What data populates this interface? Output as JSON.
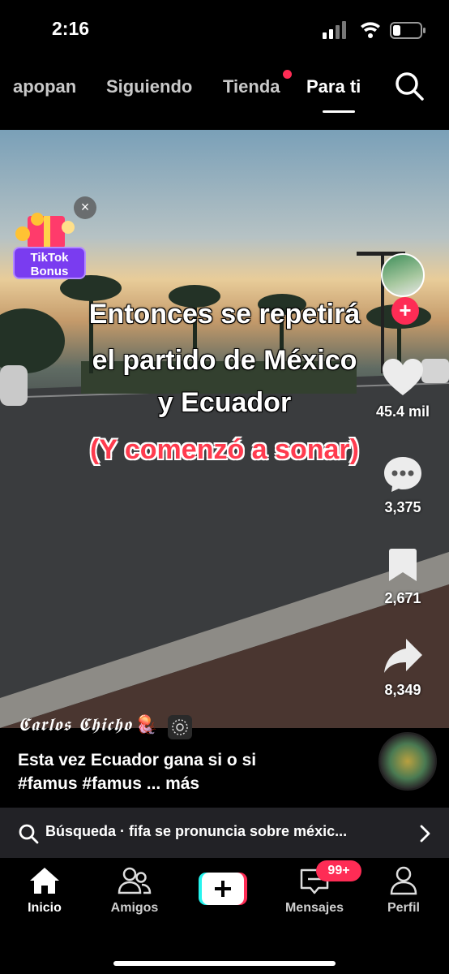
{
  "status_bar": {
    "time": "2:16"
  },
  "top_nav": {
    "tabs": [
      {
        "label": "apopan"
      },
      {
        "label": "Siguiendo"
      },
      {
        "label": "Tienda"
      },
      {
        "label": "Para ti"
      }
    ]
  },
  "video": {
    "overlay_lines": [
      "Entonces se repetirá",
      "el partido de México",
      "y Ecuador"
    ],
    "overlay_red": "(Y comenzó a sonar)",
    "bonus": {
      "line1": "TikTok",
      "line2": "Bonus",
      "close": "×"
    }
  },
  "actions": {
    "likes": "45.4 mil",
    "comments": "3,375",
    "saves": "2,671",
    "shares": "8,349"
  },
  "post": {
    "author": "𝕮𝖆𝖗𝖑𝖔𝖘 𝕮𝖍𝖎𝖈𝖍𝖔",
    "author_emoji": "🪼",
    "caption_line1": "Esta vez Ecuador gana si o si",
    "caption_line2": "#famus #famus ... más"
  },
  "search_suggestion": "Búsqueda · fifa se pronuncia sobre méxic...",
  "bottom_nav": {
    "items": [
      {
        "label": "Inicio"
      },
      {
        "label": "Amigos"
      },
      {
        "label": "Mensajes"
      },
      {
        "label": "Perfil"
      }
    ],
    "messages_badge": "99+"
  },
  "colors": {
    "accent": "#fe2c55",
    "bonus": "#7a3cf0",
    "overlay_red": "#ff3b4e"
  }
}
